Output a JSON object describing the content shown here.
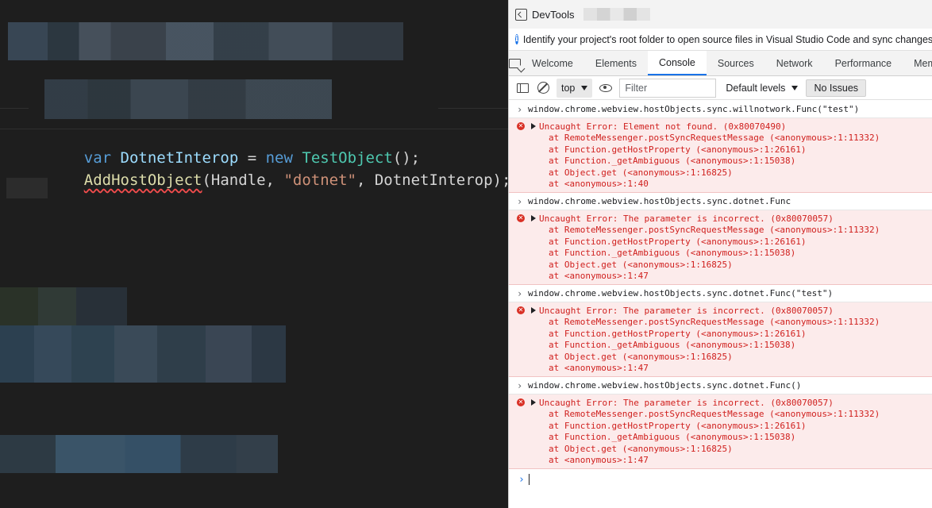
{
  "editor": {
    "line1": {
      "kw": "var",
      "name": "DotnetInterop",
      "eq": " = ",
      "kw2": "new",
      "cls": "TestObject",
      "end": "();"
    },
    "line2": {
      "fn": "AddHostObject",
      "open": "(Handle, ",
      "str": "\"dotnet\"",
      "rest": ", DotnetInterop);"
    }
  },
  "devtools": {
    "title": "DevTools",
    "info": "Identify your project's root folder to open source files in Visual Studio Code and sync changes.",
    "tabs": [
      "Welcome",
      "Elements",
      "Console",
      "Sources",
      "Network",
      "Performance",
      "Memo"
    ],
    "active_tab": "Console",
    "toolbar": {
      "context": "top",
      "filter_placeholder": "Filter",
      "levels": "Default levels",
      "issues": "No Issues"
    }
  },
  "console": {
    "entries": [
      {
        "command": "window.chrome.webview.hostObjects.sync.willnotwork.Func(\"test\")",
        "error": "Uncaught Error: Element not found. (0x80070490)",
        "stack": [
          "at RemoteMessenger.postSyncRequestMessage (<anonymous>:1:11332)",
          "at Function.getHostProperty (<anonymous>:1:26161)",
          "at Function._getAmbiguous (<anonymous>:1:15038)",
          "at Object.get (<anonymous>:1:16825)",
          "at <anonymous>:1:40"
        ]
      },
      {
        "command": "window.chrome.webview.hostObjects.sync.dotnet.Func",
        "error": "Uncaught Error: The parameter is incorrect. (0x80070057)",
        "stack": [
          "at RemoteMessenger.postSyncRequestMessage (<anonymous>:1:11332)",
          "at Function.getHostProperty (<anonymous>:1:26161)",
          "at Function._getAmbiguous (<anonymous>:1:15038)",
          "at Object.get (<anonymous>:1:16825)",
          "at <anonymous>:1:47"
        ]
      },
      {
        "command": "window.chrome.webview.hostObjects.sync.dotnet.Func(\"test\")",
        "error": "Uncaught Error: The parameter is incorrect. (0x80070057)",
        "stack": [
          "at RemoteMessenger.postSyncRequestMessage (<anonymous>:1:11332)",
          "at Function.getHostProperty (<anonymous>:1:26161)",
          "at Function._getAmbiguous (<anonymous>:1:15038)",
          "at Object.get (<anonymous>:1:16825)",
          "at <anonymous>:1:47"
        ]
      },
      {
        "command": "window.chrome.webview.hostObjects.sync.dotnet.Func()",
        "error": "Uncaught Error: The parameter is incorrect. (0x80070057)",
        "stack": [
          "at RemoteMessenger.postSyncRequestMessage (<anonymous>:1:11332)",
          "at Function.getHostProperty (<anonymous>:1:26161)",
          "at Function._getAmbiguous (<anonymous>:1:15038)",
          "at Object.get (<anonymous>:1:16825)",
          "at <anonymous>:1:47"
        ]
      }
    ],
    "prompt": "›"
  },
  "colors": {
    "editor_bg": "#1e1e1e",
    "keyword": "#569cd6",
    "class": "#4ec9b0",
    "function": "#dcdcaa",
    "string": "#ce9178",
    "error_bg": "#fcebeb",
    "error_text": "#d0201e",
    "accent": "#1a73e8"
  }
}
